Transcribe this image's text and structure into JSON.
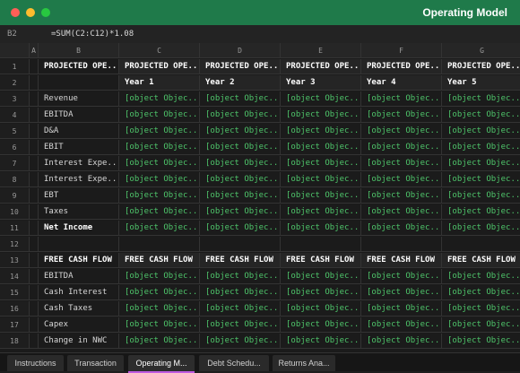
{
  "window": {
    "title": "Operating Model"
  },
  "formula_bar": {
    "cell_ref": "B2",
    "formula": "=SUM(C2:C12)*1.08"
  },
  "columns": [
    "A",
    "B",
    "C",
    "D",
    "E",
    "F",
    "G"
  ],
  "rows": [
    {
      "num": "1",
      "b": "PROJECTED OPE...",
      "vals": [
        "PROJECTED OPE...",
        "PROJECTED OPE...",
        "PROJECTED OPE...",
        "PROJECTED OPE...",
        "PROJECTED OPE..."
      ]
    },
    {
      "num": "2",
      "b": "",
      "vals": [
        "Year 1",
        "Year 2",
        "Year 3",
        "Year 4",
        "Year 5"
      ]
    },
    {
      "num": "3",
      "b": "Revenue",
      "vals": [
        "[object Objec...",
        "[object Objec...",
        "[object Objec...",
        "[object Objec...",
        "[object Objec..."
      ]
    },
    {
      "num": "4",
      "b": "EBITDA",
      "vals": [
        "[object Objec...",
        "[object Objec...",
        "[object Objec...",
        "[object Objec...",
        "[object Objec..."
      ]
    },
    {
      "num": "5",
      "b": "D&A",
      "vals": [
        "[object Objec...",
        "[object Objec...",
        "[object Objec...",
        "[object Objec...",
        "[object Objec..."
      ]
    },
    {
      "num": "6",
      "b": "EBIT",
      "vals": [
        "[object Objec...",
        "[object Objec...",
        "[object Objec...",
        "[object Objec...",
        "[object Objec..."
      ]
    },
    {
      "num": "7",
      "b": "Interest Expe...",
      "vals": [
        "[object Objec...",
        "[object Objec...",
        "[object Objec...",
        "[object Objec...",
        "[object Objec..."
      ]
    },
    {
      "num": "8",
      "b": "Interest Expe...",
      "vals": [
        "[object Objec...",
        "[object Objec...",
        "[object Objec...",
        "[object Objec...",
        "[object Objec..."
      ]
    },
    {
      "num": "9",
      "b": "EBT",
      "vals": [
        "[object Objec...",
        "[object Objec...",
        "[object Objec...",
        "[object Objec...",
        "[object Objec..."
      ]
    },
    {
      "num": "10",
      "b": "Taxes",
      "vals": [
        "[object Objec...",
        "[object Objec...",
        "[object Objec...",
        "[object Objec...",
        "[object Objec..."
      ]
    },
    {
      "num": "11",
      "b": "Net Income",
      "vals": [
        "[object Objec...",
        "[object Objec...",
        "[object Objec...",
        "[object Objec...",
        "[object Objec..."
      ]
    },
    {
      "num": "12",
      "b": "",
      "vals": [
        "",
        "",
        "",
        "",
        ""
      ]
    },
    {
      "num": "13",
      "b": "FREE CASH FLOW",
      "vals": [
        "FREE CASH FLOW",
        "FREE CASH FLOW",
        "FREE CASH FLOW",
        "FREE CASH FLOW",
        "FREE CASH FLOW"
      ]
    },
    {
      "num": "14",
      "b": "EBITDA",
      "vals": [
        "[object Objec...",
        "[object Objec...",
        "[object Objec...",
        "[object Objec...",
        "[object Objec..."
      ]
    },
    {
      "num": "15",
      "b": "Cash Interest",
      "vals": [
        "[object Objec...",
        "[object Objec...",
        "[object Objec...",
        "[object Objec...",
        "[object Objec..."
      ]
    },
    {
      "num": "16",
      "b": "Cash Taxes",
      "vals": [
        "[object Objec...",
        "[object Objec...",
        "[object Objec...",
        "[object Objec...",
        "[object Objec..."
      ]
    },
    {
      "num": "17",
      "b": "Capex",
      "vals": [
        "[object Objec...",
        "[object Objec...",
        "[object Objec...",
        "[object Objec...",
        "[object Objec..."
      ]
    },
    {
      "num": "18",
      "b": "Change in NWC",
      "vals": [
        "[object Objec...",
        "[object Objec...",
        "[object Objec...",
        "[object Objec...",
        "[object Objec..."
      ]
    }
  ],
  "sheet_tabs": [
    {
      "label": "Instructions",
      "active": false
    },
    {
      "label": "Transaction",
      "active": false
    },
    {
      "label": "Operating M...",
      "active": true
    },
    {
      "label": "Debt Schedu...",
      "active": false
    },
    {
      "label": "Returns Ana...",
      "active": false
    }
  ],
  "colors": {
    "titlebar": "#1f7a4a",
    "value_text": "#4ec46a",
    "active_tab_accent": "#c05ae0"
  }
}
